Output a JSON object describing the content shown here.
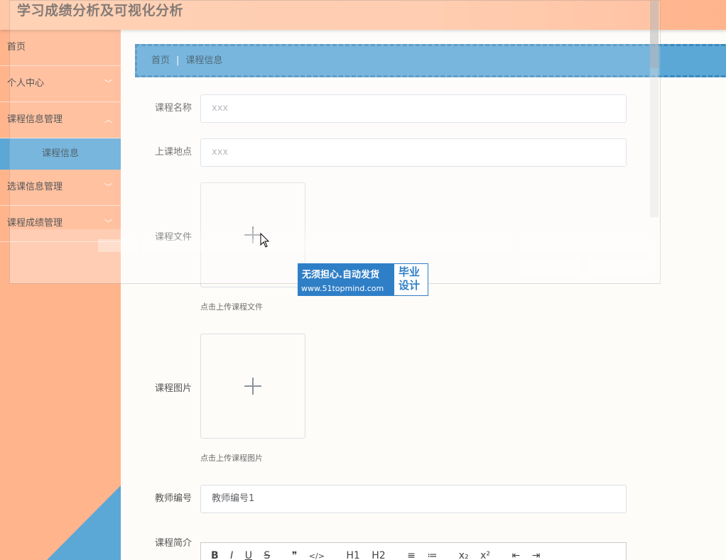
{
  "app": {
    "title": "学习成绩分析及可视化分析"
  },
  "sidebar": {
    "items": [
      {
        "label": "首页"
      },
      {
        "label": "个人中心"
      },
      {
        "label": "课程信息管理"
      },
      {
        "label": "课程信息"
      },
      {
        "label": "选课信息管理"
      },
      {
        "label": "课程成绩管理"
      }
    ]
  },
  "breadcrumb": {
    "home": "首页",
    "separator": "|",
    "current": "课程信息"
  },
  "form": {
    "course_name": {
      "label": "课程名称",
      "placeholder": "xxx"
    },
    "location": {
      "label": "上课地点",
      "placeholder": "xxx"
    },
    "course_file": {
      "label": "课程文件",
      "hint": "点击上传课程文件"
    },
    "course_image": {
      "label": "课程图片",
      "hint": "点击上传课程图片"
    },
    "teacher_id": {
      "label": "教师编号",
      "value": "教师编号1"
    },
    "course_intro": {
      "label": "课程简介"
    }
  },
  "editor_toolbar": [
    "B",
    "I",
    "U",
    "S",
    "❞",
    "</>",
    "H1",
    "H2",
    "≡",
    "≔",
    "x₂",
    "x²",
    "⇤",
    "⇥"
  ],
  "watermark": {
    "line1": "无须担心.自动发货",
    "line2": "www.51topmind.com",
    "right1": "毕业",
    "right2": "设计"
  },
  "colors": {
    "header": "#ffc2a0",
    "sidebar": "#ffb48c",
    "accent": "#5ba7d6",
    "brand": "#2f7fc7"
  }
}
